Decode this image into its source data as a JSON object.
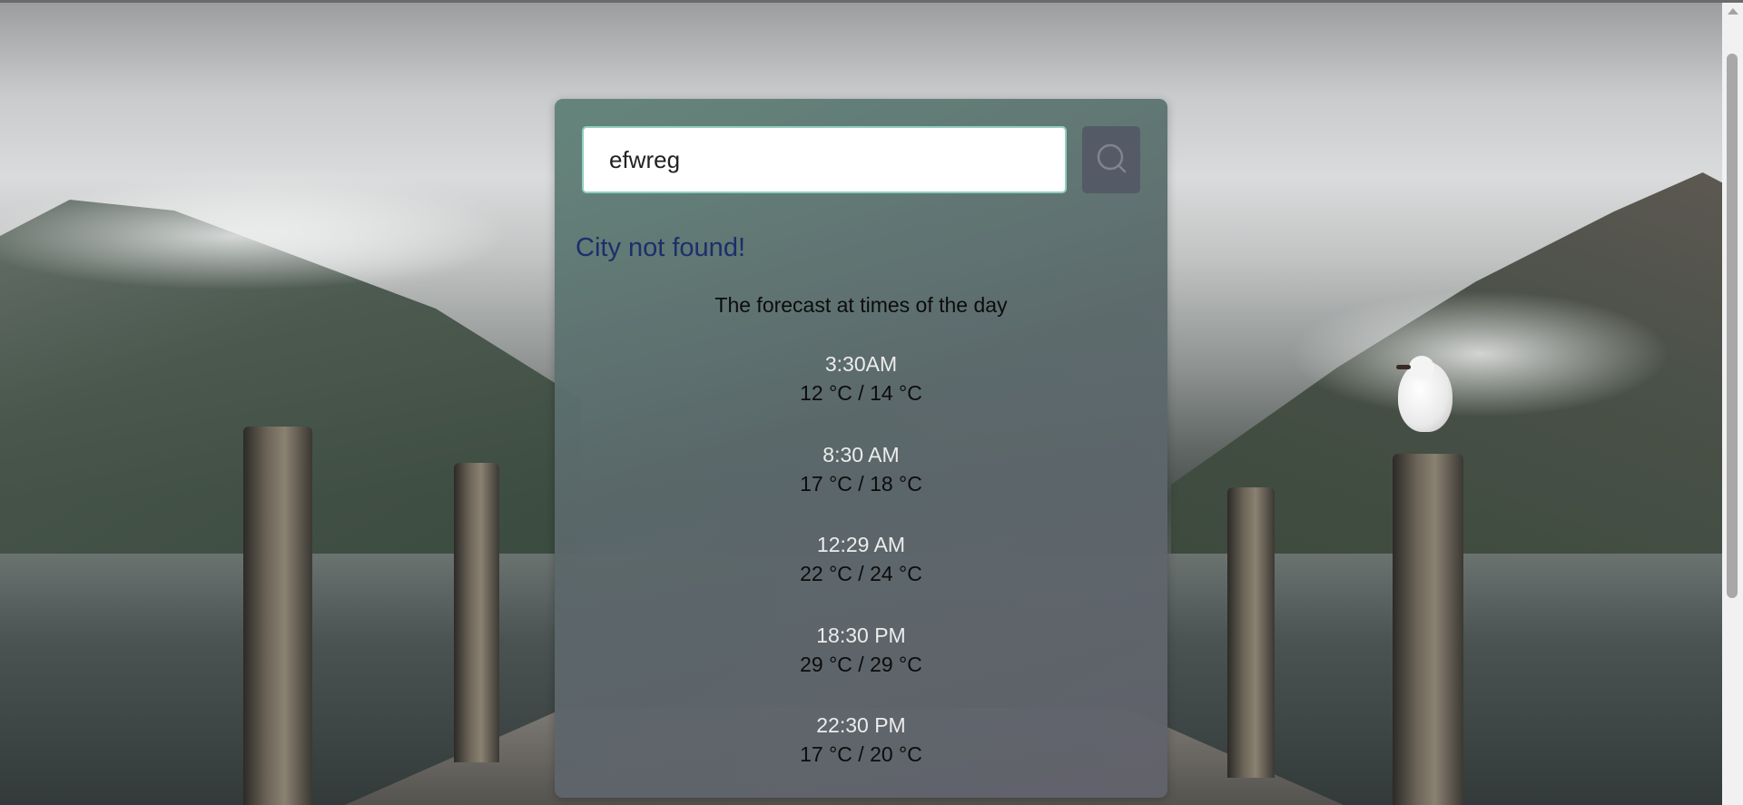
{
  "search": {
    "value": "efwreg",
    "placeholder": "",
    "button_icon": "search-icon"
  },
  "error_message": "City not found!",
  "forecast": {
    "title": "The forecast at times of the day",
    "items": [
      {
        "time": "3:30AM",
        "temps": "12 °C / 14 °C"
      },
      {
        "time": "8:30 AM",
        "temps": "17 °C / 18 °C"
      },
      {
        "time": "12:29 AM",
        "temps": "22 °C / 24 °C"
      },
      {
        "time": "18:30 PM",
        "temps": "29 °C / 29 °C"
      },
      {
        "time": "22:30 PM",
        "temps": "17 °C / 20 °C"
      }
    ]
  },
  "colors": {
    "error_text": "#1b2f6b",
    "input_border": "#8fcfc0",
    "search_button": "#555b66"
  }
}
